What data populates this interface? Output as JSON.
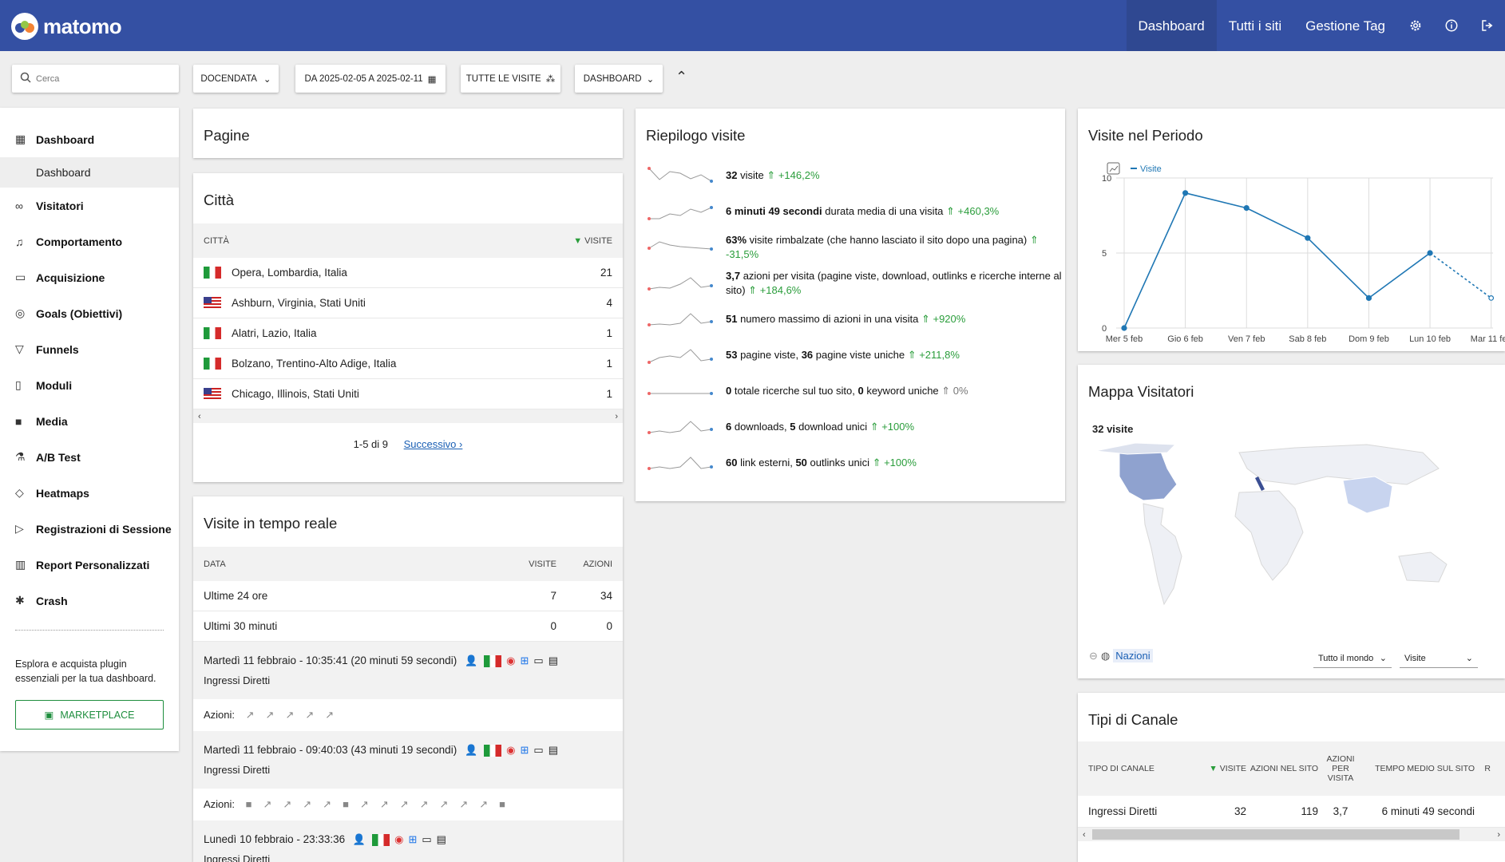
{
  "topbar": {
    "logo_text": "matomo",
    "nav": [
      "Dashboard",
      "Tutti i siti",
      "Gestione Tag"
    ],
    "icons": [
      "gear-icon",
      "info-icon",
      "logout-icon"
    ]
  },
  "controls": {
    "search_placeholder": "Cerca",
    "site": "DOCENDATA",
    "period": "DA 2025-02-05 A 2025-02-11",
    "segment": "TUTTE LE VISITE",
    "dashboard": "DASHBOARD"
  },
  "sidebar": {
    "items": [
      {
        "label": "Dashboard",
        "icon": "grid-icon"
      },
      {
        "label": "Visitatori",
        "icon": "people-icon"
      },
      {
        "label": "Comportamento",
        "icon": "bell-icon"
      },
      {
        "label": "Acquisizione",
        "icon": "acquisition-icon"
      },
      {
        "label": "Goals (Obiettivi)",
        "icon": "target-icon"
      },
      {
        "label": "Funnels",
        "icon": "funnel-icon"
      },
      {
        "label": "Moduli",
        "icon": "clipboard-icon"
      },
      {
        "label": "Media",
        "icon": "media-icon"
      },
      {
        "label": "A/B Test",
        "icon": "flask-icon"
      },
      {
        "label": "Heatmaps",
        "icon": "heatmap-icon"
      },
      {
        "label": "Registrazioni di Sessione",
        "icon": "play-icon"
      },
      {
        "label": "Report Personalizzati",
        "icon": "report-icon"
      },
      {
        "label": "Crash",
        "icon": "bug-icon"
      }
    ],
    "sub_item": "Dashboard",
    "promo": "Esplora e acquista plugin essenziali per la tua dashboard.",
    "marketplace": "MARKETPLACE"
  },
  "pagine": {
    "title": "Pagine"
  },
  "citta": {
    "title": "Città",
    "col_city": "CITTÀ",
    "col_visits": "VISITE",
    "rows": [
      {
        "city": "Opera, Lombardia, Italia",
        "visits": "21",
        "flag": "it"
      },
      {
        "city": "Ashburn, Virginia, Stati Uniti",
        "visits": "4",
        "flag": "us"
      },
      {
        "city": "Alatri, Lazio, Italia",
        "visits": "1",
        "flag": "it"
      },
      {
        "city": "Bolzano, Trentino-Alto Adige, Italia",
        "visits": "1",
        "flag": "it"
      },
      {
        "city": "Chicago, Illinois, Stati Uniti",
        "visits": "1",
        "flag": "us"
      }
    ],
    "pagination": "1-5 di 9",
    "next": "Successivo ›"
  },
  "realtime": {
    "title": "Visite in tempo reale",
    "col_data": "DATA",
    "col_visite": "VISITE",
    "col_azioni": "AZIONI",
    "rows": [
      {
        "label": "Ultime 24 ore",
        "visite": "7",
        "azioni": "34"
      },
      {
        "label": "Ultimi 30 minuti",
        "visite": "0",
        "azioni": "0"
      }
    ],
    "visits": [
      {
        "time": "Martedì 11 febbraio - 10:35:41 (20 minuti 59 secondi)",
        "source": "Ingressi Diretti",
        "actions_label": "Azioni:"
      },
      {
        "time": "Martedì 11 febbraio - 09:40:03 (43 minuti 19 secondi)",
        "source": "Ingressi Diretti",
        "actions_label": "Azioni:"
      },
      {
        "time": "Lunedì 10 febbraio - 23:33:36",
        "source": "Ingressi Diretti"
      }
    ]
  },
  "riepilogo": {
    "title": "Riepilogo visite",
    "rows": [
      {
        "b1": "32",
        "t1": " visite",
        "d": "+146,2%"
      },
      {
        "b1": "6 minuti 49 secondi",
        "t1": " durata media di una visita",
        "d": "+460,3%"
      },
      {
        "b1": "63%",
        "t1": " visite rimbalzate (che hanno lasciato il sito dopo una pagina)",
        "d": "-31,5%"
      },
      {
        "b1": "3,7",
        "t1": " azioni per visita (pagine viste, download, outlinks e ricerche interne al sito)",
        "d": "+184,6%"
      },
      {
        "b1": "51",
        "t1": " numero massimo di azioni in una visita",
        "d": "+920%"
      },
      {
        "b1": "53",
        "t1": " pagine viste, ",
        "b2": "36",
        "t2": " pagine viste uniche",
        "d": "+211,8%"
      },
      {
        "b1": "0",
        "t1": " totale ricerche sul tuo sito, ",
        "b2": "0",
        "t2": " keyword uniche",
        "d": "0%"
      },
      {
        "b1": "6",
        "t1": " downloads, ",
        "b2": "5",
        "t2": " download unici",
        "d": "+100%"
      },
      {
        "b1": "60",
        "t1": " link esterni, ",
        "b2": "50",
        "t2": " outlinks unici",
        "d": "+100%"
      }
    ]
  },
  "periodo": {
    "title": "Visite nel Periodo",
    "legend": "Visite"
  },
  "chart_data": {
    "type": "line",
    "categories": [
      "Mer 5 feb",
      "Gio 6 feb",
      "Ven 7 feb",
      "Sab 8 feb",
      "Dom 9 feb",
      "Lun 10 feb",
      "Mar 11 feb"
    ],
    "series": [
      {
        "name": "Visite",
        "values": [
          0,
          9,
          8,
          6,
          2,
          5,
          2
        ]
      }
    ],
    "ylim": [
      0,
      10
    ],
    "yticks": [
      "10",
      "5",
      "0"
    ],
    "grid": true,
    "last_segment": "dashed"
  },
  "mappa": {
    "title": "Mappa Visitatori",
    "visits_label": "32 visite",
    "nazioni": "Nazioni",
    "region": "Tutto il mondo",
    "metric": "Visite"
  },
  "canali": {
    "title": "Tipi di Canale",
    "cols": [
      "TIPO DI CANALE",
      "VISITE",
      "AZIONI NEL SITO",
      "AZIONI PER VISITA",
      "TEMPO MEDIO SUL SITO",
      "R"
    ],
    "row": {
      "type": "Ingressi Diretti",
      "visite": "32",
      "azioni": "119",
      "per_visita": "3,7",
      "tempo": "6 minuti 49 secondi"
    }
  }
}
